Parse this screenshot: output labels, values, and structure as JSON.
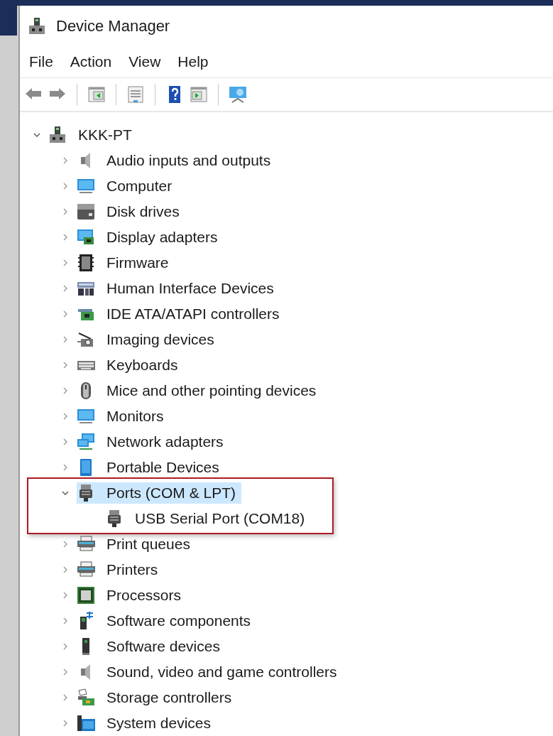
{
  "window": {
    "title": "Device Manager"
  },
  "menu": [
    "File",
    "Action",
    "View",
    "Help"
  ],
  "toolbar": [
    {
      "kind": "back"
    },
    {
      "kind": "forward"
    },
    {
      "kind": "sep"
    },
    {
      "kind": "panel-left"
    },
    {
      "kind": "sep"
    },
    {
      "kind": "sheet"
    },
    {
      "kind": "sep"
    },
    {
      "kind": "help"
    },
    {
      "kind": "panel-right"
    },
    {
      "kind": "sep"
    },
    {
      "kind": "scan"
    }
  ],
  "tree": [
    {
      "label": "KKK-PT",
      "kind": "computer",
      "expanded": true,
      "selected": false,
      "children": [
        {
          "label": "Audio inputs and outputs",
          "kind": "speaker",
          "expanded": false,
          "selected": false
        },
        {
          "label": "Computer",
          "kind": "monitor",
          "expanded": false,
          "selected": false
        },
        {
          "label": "Disk drives",
          "kind": "drive",
          "expanded": false,
          "selected": false
        },
        {
          "label": "Display adapters",
          "kind": "adapter",
          "expanded": false,
          "selected": false
        },
        {
          "label": "Firmware",
          "kind": "chip",
          "expanded": false,
          "selected": false
        },
        {
          "label": "Human Interface Devices",
          "kind": "hid",
          "expanded": false,
          "selected": false
        },
        {
          "label": "IDE ATA/ATAPI controllers",
          "kind": "card",
          "expanded": false,
          "selected": false
        },
        {
          "label": "Imaging devices",
          "kind": "camera",
          "expanded": false,
          "selected": false
        },
        {
          "label": "Keyboards",
          "kind": "keyboard",
          "expanded": false,
          "selected": false
        },
        {
          "label": "Mice and other pointing devices",
          "kind": "mouse",
          "expanded": false,
          "selected": false
        },
        {
          "label": "Monitors",
          "kind": "monitor",
          "expanded": false,
          "selected": false
        },
        {
          "label": "Network adapters",
          "kind": "network",
          "expanded": false,
          "selected": false
        },
        {
          "label": "Portable Devices",
          "kind": "portable",
          "expanded": false,
          "selected": false
        },
        {
          "label": "Ports (COM & LPT)",
          "kind": "port",
          "expanded": true,
          "selected": true,
          "highlighted": true,
          "children": [
            {
              "label": "USB Serial Port (COM18)",
              "kind": "port",
              "selected": false
            }
          ]
        },
        {
          "label": "Print queues",
          "kind": "printer",
          "expanded": false,
          "selected": false
        },
        {
          "label": "Printers",
          "kind": "printer",
          "expanded": false,
          "selected": false
        },
        {
          "label": "Processors",
          "kind": "processor",
          "expanded": false,
          "selected": false
        },
        {
          "label": "Software components",
          "kind": "component",
          "expanded": false,
          "selected": false
        },
        {
          "label": "Software devices",
          "kind": "tower",
          "expanded": false,
          "selected": false
        },
        {
          "label": "Sound, video and game controllers",
          "kind": "speaker",
          "expanded": false,
          "selected": false
        },
        {
          "label": "Storage controllers",
          "kind": "storage",
          "expanded": false,
          "selected": false
        },
        {
          "label": "System devices",
          "kind": "folder",
          "expanded": false,
          "selected": false
        }
      ]
    }
  ]
}
